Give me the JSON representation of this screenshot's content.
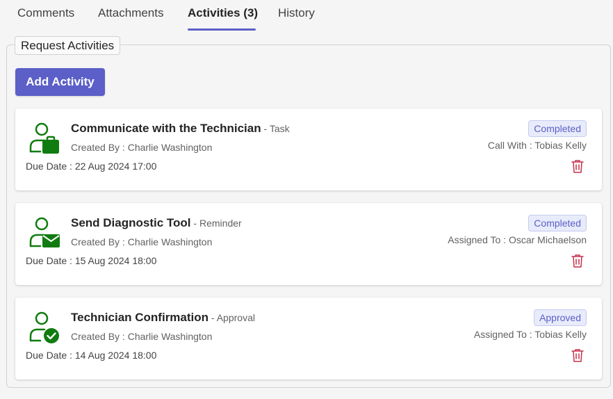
{
  "tabs": [
    {
      "label": "Comments",
      "active": false
    },
    {
      "label": "Attachments",
      "active": false
    },
    {
      "label": "Activities (3)",
      "active": true
    },
    {
      "label": "History",
      "active": false
    }
  ],
  "section": {
    "legend": "Request Activities",
    "add_button": "Add Activity"
  },
  "colors": {
    "accent": "#5b5fc7",
    "icon_green": "#107c10",
    "delete_red": "#c4314b"
  },
  "activities": [
    {
      "icon": "person-briefcase-icon",
      "title": "Communicate with the Technician",
      "separator": " - ",
      "type": "Task",
      "created_by": "Created By : Charlie Washington",
      "due": "Due Date : 22 Aug 2024 17:00",
      "status": "Completed",
      "assignee": "Call With : Tobias Kelly"
    },
    {
      "icon": "person-mail-icon",
      "title": "Send Diagnostic Tool",
      "separator": " - ",
      "type": "Reminder",
      "created_by": "Created By : Charlie Washington",
      "due": "Due Date : 15 Aug 2024 18:00",
      "status": "Completed",
      "assignee": "Assigned To : Oscar Michaelson"
    },
    {
      "icon": "person-check-icon",
      "title": "Technician Confirmation",
      "separator": " - ",
      "type": "Approval",
      "created_by": "Created By : Charlie Washington",
      "due": "Due Date : 14 Aug 2024 18:00",
      "status": "Approved",
      "assignee": "Assigned To : Tobias Kelly"
    }
  ]
}
